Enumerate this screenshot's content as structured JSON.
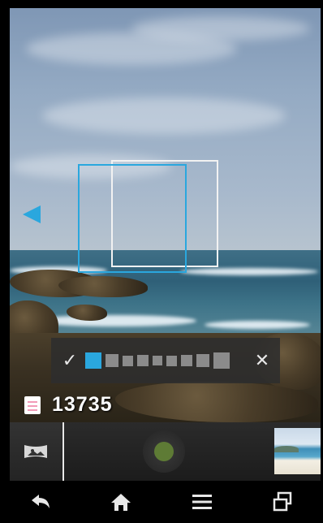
{
  "camera": {
    "mode": "panorama",
    "shot_counter": "13735",
    "pan_direction": "left",
    "shutter_state": "ready",
    "colors": {
      "accent": "#2aa7de",
      "shutter": "#5e7b35",
      "overlay_bg": "#2d2d2d"
    }
  },
  "preset_bar": {
    "confirm_icon": "check-icon",
    "confirm_glyph": "✓",
    "cancel_icon": "close-icon",
    "cancel_glyph": "✕",
    "presets": [
      {
        "label": "size-1",
        "selected": true
      },
      {
        "label": "size-2",
        "selected": false
      },
      {
        "label": "size-3",
        "selected": false
      },
      {
        "label": "size-4",
        "selected": false
      },
      {
        "label": "size-5",
        "selected": false
      },
      {
        "label": "size-6",
        "selected": false
      },
      {
        "label": "size-7",
        "selected": false
      },
      {
        "label": "size-8",
        "selected": false
      },
      {
        "label": "size-9",
        "selected": false
      }
    ]
  },
  "navbar": {
    "items": [
      {
        "name": "back",
        "icon": "back-arrow-icon"
      },
      {
        "name": "home",
        "icon": "home-icon"
      },
      {
        "name": "menu",
        "icon": "menu-icon"
      },
      {
        "name": "recent-apps",
        "icon": "recent-apps-icon"
      }
    ]
  }
}
